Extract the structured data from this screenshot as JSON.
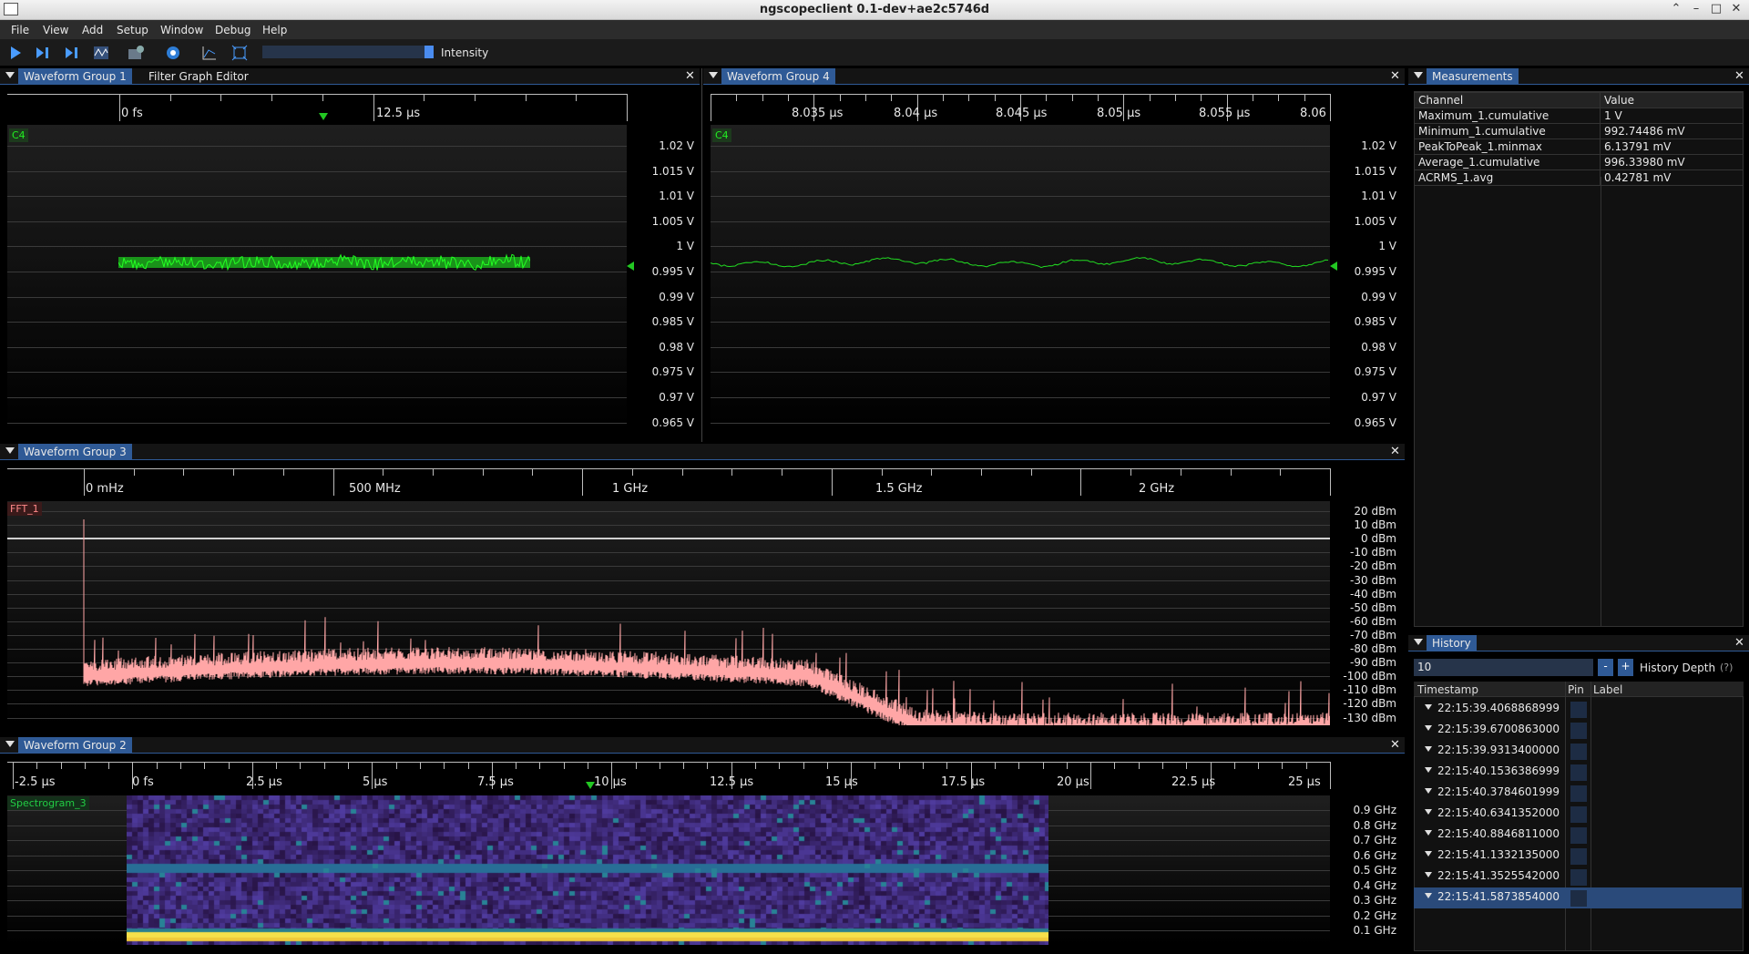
{
  "window": {
    "title": "ngscopeclient 0.1-dev+ae2c5746d"
  },
  "menu": [
    "File",
    "View",
    "Add",
    "Setup",
    "Window",
    "Debug",
    "Help"
  ],
  "toolbar": {
    "icons": [
      "play-icon",
      "single-trigger-icon",
      "force-trigger-icon",
      "waveform-icon",
      "instrument-icon",
      "settings-icon",
      "graph-icon",
      "fullscreen-icon"
    ],
    "intensity_label": "Intensity",
    "intensity_value": 0.95
  },
  "group1": {
    "tabs": [
      "Waveform Group 1",
      "Filter Graph Editor"
    ],
    "channel": "C4",
    "x_ticks": [
      "0 fs",
      "12.5 µs"
    ],
    "y_ticks": [
      "1.02 V",
      "1.015 V",
      "1.01 V",
      "1.005 V",
      "1 V",
      "0.995 V",
      "0.99 V",
      "0.985 V",
      "0.98 V",
      "0.975 V",
      "0.97 V",
      "0.965 V"
    ]
  },
  "group4": {
    "tabs": [
      "Waveform Group 4"
    ],
    "channel": "C4",
    "x_ticks": [
      "8.035 µs",
      "8.04 µs",
      "8.045 µs",
      "8.05 µs",
      "8.055 µs",
      "8.06"
    ],
    "y_ticks": [
      "1.02 V",
      "1.015 V",
      "1.01 V",
      "1.005 V",
      "1 V",
      "0.995 V",
      "0.99 V",
      "0.985 V",
      "0.98 V",
      "0.975 V",
      "0.97 V",
      "0.965 V"
    ]
  },
  "group3": {
    "tabs": [
      "Waveform Group 3"
    ],
    "channel": "FFT_1",
    "x_ticks": [
      "0 mHz",
      "500 MHz",
      "1 GHz",
      "1.5 GHz",
      "2 GHz"
    ],
    "y_ticks": [
      "20 dBm",
      "10 dBm",
      "0 dBm",
      "-10 dBm",
      "-20 dBm",
      "-30 dBm",
      "-40 dBm",
      "-50 dBm",
      "-60 dBm",
      "-70 dBm",
      "-80 dBm",
      "-90 dBm",
      "-100 dBm",
      "-110 dBm",
      "-120 dBm",
      "-130 dBm"
    ]
  },
  "group2": {
    "tabs": [
      "Waveform Group 2"
    ],
    "channel": "Spectrogram_3",
    "x_ticks": [
      "-2.5 µs",
      "0 fs",
      "2.5 µs",
      "5 µs",
      "7.5 µs",
      "10 µs",
      "12.5 µs",
      "15 µs",
      "17.5 µs",
      "20 µs",
      "22.5 µs",
      "25 µs"
    ],
    "y_ticks": [
      "0.9 GHz",
      "0.8 GHz",
      "0.7 GHz",
      "0.6 GHz",
      "0.5 GHz",
      "0.4 GHz",
      "0.3 GHz",
      "0.2 GHz",
      "0.1 GHz"
    ]
  },
  "measurements": {
    "tab": "Measurements",
    "columns": [
      "Channel",
      "Value"
    ],
    "rows": [
      [
        "Maximum_1.cumulative",
        "1 V"
      ],
      [
        "Minimum_1.cumulative",
        "992.74486 mV"
      ],
      [
        "PeakToPeak_1.minmax",
        "6.13791 mV"
      ],
      [
        "Average_1.cumulative",
        "996.33980 mV"
      ],
      [
        "ACRMS_1.avg",
        "0.42781 mV"
      ]
    ]
  },
  "history": {
    "tab": "History",
    "depth_value": "10",
    "minus": "-",
    "plus": "+",
    "depth_label": "History Depth",
    "help": "(?)",
    "columns": [
      "Timestamp",
      "Pin",
      "Label"
    ],
    "rows": [
      "22:15:39.4068868999",
      "22:15:39.6700863000",
      "22:15:39.9313400000",
      "22:15:40.1536386999",
      "22:15:40.3784601999",
      "22:15:40.6341352000",
      "22:15:40.8846811000",
      "22:15:41.1332135000",
      "22:15:41.3525542000",
      "22:15:41.5873854000"
    ],
    "selected_index": 9
  },
  "colors": {
    "accent": "#2f5a96",
    "channel_c4": "#00ff00",
    "fft": "#ff9a9a"
  }
}
